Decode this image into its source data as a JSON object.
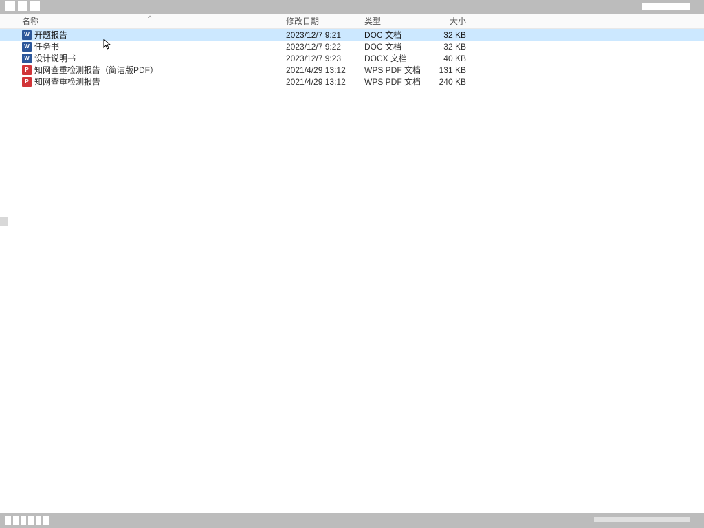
{
  "columns": {
    "name": "名称",
    "date": "修改日期",
    "type": "类型",
    "size": "大小"
  },
  "files": [
    {
      "icon": "word",
      "iconLetter": "W",
      "name": "开题报告",
      "date": "2023/12/7 9:21",
      "type": "DOC 文档",
      "size": "32 KB",
      "selected": true
    },
    {
      "icon": "word",
      "iconLetter": "W",
      "name": "任务书",
      "date": "2023/12/7 9:22",
      "type": "DOC 文档",
      "size": "32 KB",
      "selected": false
    },
    {
      "icon": "word",
      "iconLetter": "W",
      "name": "设计说明书",
      "date": "2023/12/7 9:23",
      "type": "DOCX 文档",
      "size": "40 KB",
      "selected": false
    },
    {
      "icon": "pdf",
      "iconLetter": "P",
      "name": "知网查重检测报告（简洁版PDF）",
      "date": "2021/4/29 13:12",
      "type": "WPS PDF 文档",
      "size": "131 KB",
      "selected": false
    },
    {
      "icon": "pdf",
      "iconLetter": "P",
      "name": "知网查重检测报告",
      "date": "2021/4/29 13:12",
      "type": "WPS PDF 文档",
      "size": "240 KB",
      "selected": false
    }
  ]
}
